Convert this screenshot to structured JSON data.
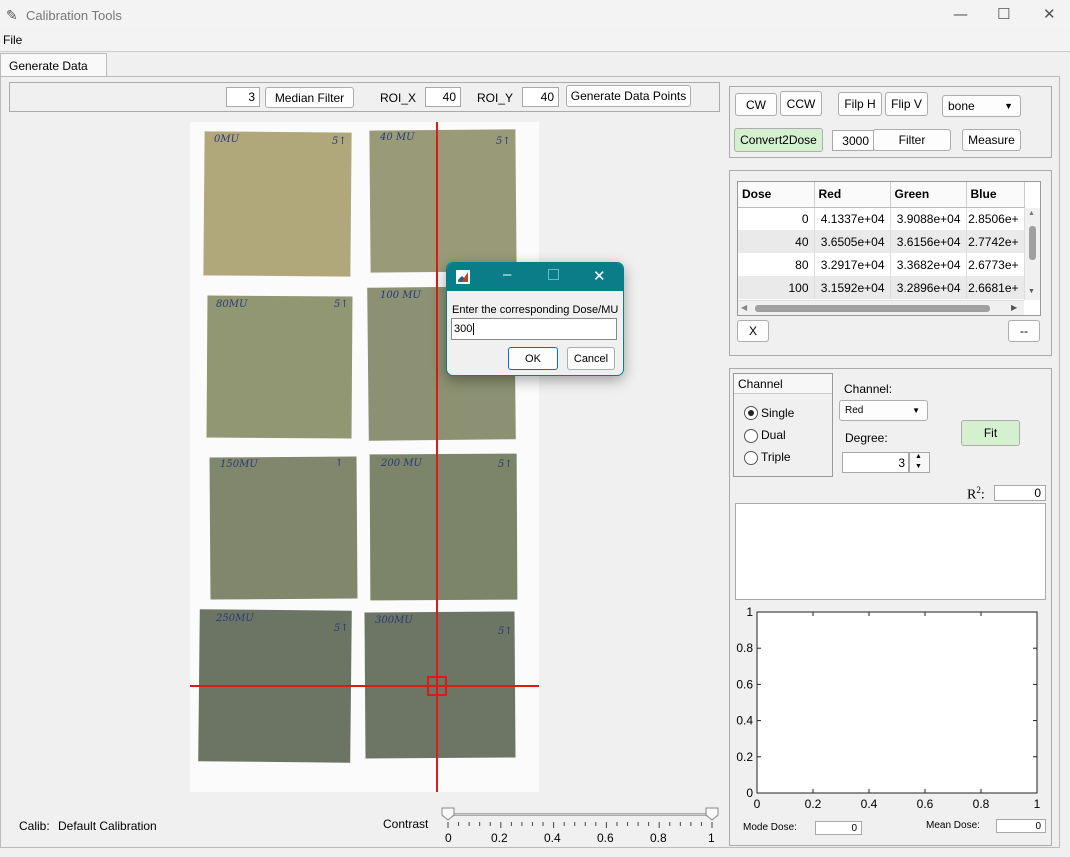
{
  "window": {
    "title": "Calibration Tools",
    "minimize": "—",
    "maximize": "☐",
    "close": "✕"
  },
  "menu": {
    "file": "File"
  },
  "tabs": [
    {
      "label": "Generate Data"
    }
  ],
  "toolbar": {
    "median_value": "3",
    "median_filter_label": "Median Filter",
    "roi_x_label": "ROI_X",
    "roi_x_value": "40",
    "roi_y_label": "ROI_Y",
    "roi_y_value": "40",
    "generate_label": "Generate Data Points"
  },
  "image_controls": {
    "cw": "CW",
    "ccw": "CCW",
    "flip_h": "Filp H",
    "flip_v": "Flip V",
    "colormap": "bone",
    "convert": "Convert2Dose",
    "filter_value": "3000",
    "filter": "Filter",
    "measure": "Measure"
  },
  "films": {
    "labels": [
      "0MU",
      "5↑",
      "40 MU",
      "5↑",
      "80MU",
      "5↑",
      "100 MU",
      "150MU",
      "↑",
      "200 MU",
      "5↑",
      "250MU",
      "5↑",
      "300MU",
      "5↑"
    ]
  },
  "data_table": {
    "headers": [
      "Dose",
      "Red",
      "Green",
      "Blue"
    ],
    "rows": [
      [
        "0",
        "4.1337e+04",
        "3.9088e+04",
        "2.8506e+"
      ],
      [
        "40",
        "3.6505e+04",
        "3.6156e+04",
        "2.7742e+"
      ],
      [
        "80",
        "3.2917e+04",
        "3.3682e+04",
        "2.6773e+"
      ],
      [
        "100",
        "3.1592e+04",
        "3.2896e+04",
        "2.6681e+"
      ]
    ],
    "delete_label": "X",
    "dash_label": "--"
  },
  "fit_panel": {
    "group_title": "Channel",
    "options": [
      "Single",
      "Dual",
      "Triple"
    ],
    "selected": "Single",
    "channel_label": "Channel:",
    "channel_value": "Red",
    "degree_label": "Degree:",
    "degree_value": "3",
    "fit_label": "Fit",
    "r2_label": "R",
    "r2_sup": "2",
    "r2_colon": ":",
    "r2_value": "0"
  },
  "chart_data": {
    "type": "line",
    "series": [],
    "xlim": [
      0,
      1
    ],
    "ylim": [
      0,
      1
    ],
    "xticks": [
      "0",
      "0.2",
      "0.4",
      "0.6",
      "0.8",
      "1"
    ],
    "yticks": [
      "0",
      "0.2",
      "0.4",
      "0.6",
      "0.8",
      "1"
    ]
  },
  "footer": {
    "calib_label": "Calib:",
    "calib_value": "Default Calibration",
    "contrast_label": "Contrast",
    "contrast_ticks": [
      "0",
      "0.2",
      "0.4",
      "0.6",
      "0.8",
      "1"
    ],
    "contrast_low": 0,
    "contrast_high": 1,
    "mode_dose_label": "Mode Dose:",
    "mode_dose_value": "0",
    "mean_dose_label": "Mean Dose:",
    "mean_dose_value": "0"
  },
  "dialog": {
    "prompt": "Enter the corresponding Dose/MU",
    "value": "300",
    "ok": "OK",
    "cancel": "Cancel"
  },
  "colors": {
    "dialog_titlebar": "#0a7e88",
    "crosshair": "#e01818",
    "green_button": "#d4f0cf"
  }
}
